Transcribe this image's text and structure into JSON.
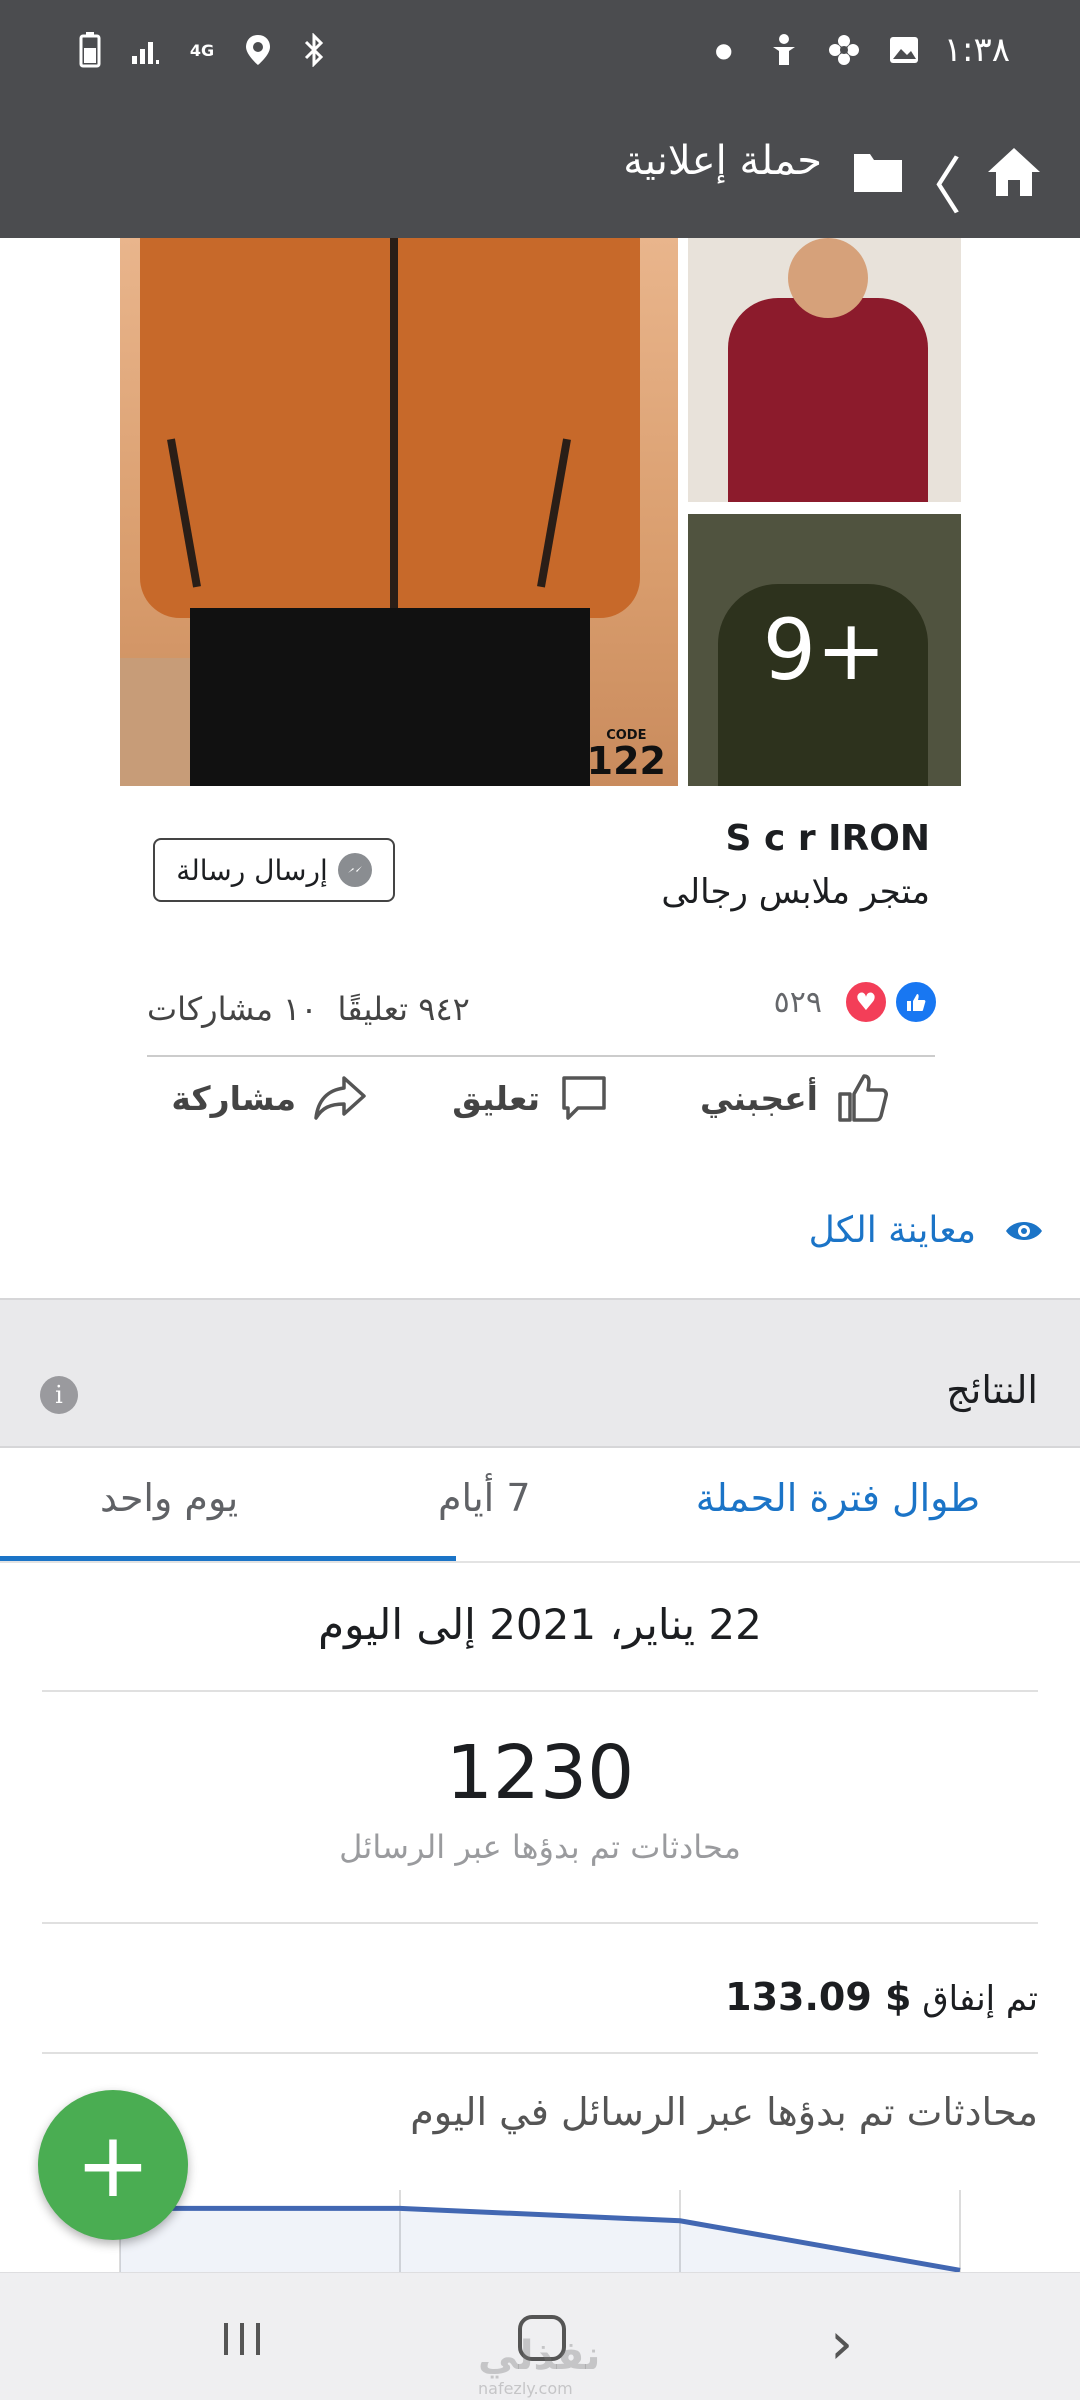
{
  "status_bar": {
    "time": "١:٣٨",
    "network": "4G"
  },
  "header": {
    "title": "حملة إعلانية"
  },
  "post": {
    "more_photos": "9+",
    "code_label": "CODE",
    "code_number": "122",
    "page_name": "S c r IRON",
    "page_category": "متجر ملابس رجالى",
    "message_button": "إرسال رسالة",
    "reaction_count": "٥٢٩",
    "comments": "٩٤٢ تعليقًا",
    "shares": "١٠ مشاركات",
    "actions": {
      "like": "أعجبني",
      "comment": "تعليق",
      "share": "مشاركة"
    }
  },
  "preview_all": "معاينة الكل",
  "results": {
    "title": "النتائج",
    "tabs": {
      "campaign": "طوال فترة الحملة",
      "seven_days": "7 أيام",
      "one_day": "يوم واحد"
    },
    "date_range": "22 يناير، 2021 إلى اليوم",
    "conversations_value": "1230",
    "conversations_label": "محادثات تم بدؤها عبر الرسائل",
    "spent_label": "تم إنفاق",
    "spent_value": "$ 133.09",
    "chart_title": "محادثات تم بدؤها عبر الرسائل في اليوم"
  },
  "watermark": {
    "text": "نفذلي",
    "sub": "nafezly.com"
  },
  "colors": {
    "header_bg": "#4b4c4f",
    "accent_blue": "#1b74c7",
    "fab_green": "#4aad52",
    "like_blue": "#1877f2",
    "love_red": "#f33e58"
  },
  "chart_data": {
    "type": "line",
    "title": "محادثات تم بدؤها عبر الرسائل في اليوم",
    "x": [
      0,
      1,
      2,
      3
    ],
    "y": [
      40,
      40,
      38,
      30
    ],
    "ylabel": "",
    "xlabel": ""
  }
}
